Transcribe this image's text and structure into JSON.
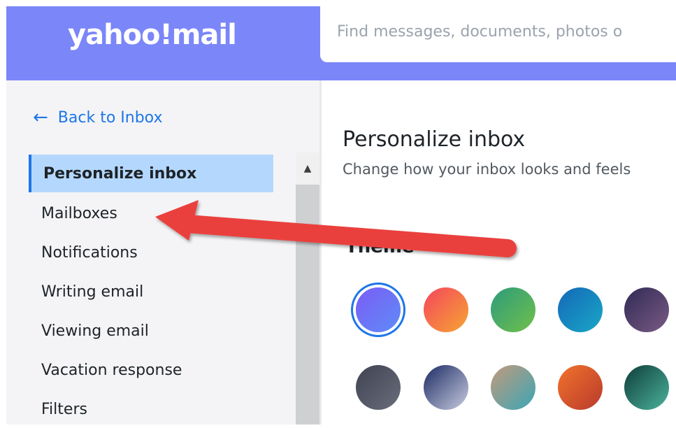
{
  "header": {
    "logo_text": "yahoo!mail",
    "search_placeholder": "Find messages, documents, photos o"
  },
  "sidebar": {
    "back_label": "Back to Inbox",
    "items": [
      {
        "label": "Personalize inbox",
        "active": true
      },
      {
        "label": "Mailboxes"
      },
      {
        "label": "Notifications"
      },
      {
        "label": "Writing email"
      },
      {
        "label": "Viewing email"
      },
      {
        "label": "Vacation response"
      },
      {
        "label": "Filters"
      }
    ]
  },
  "content": {
    "title": "Personalize inbox",
    "subtitle": "Change how your inbox looks and feels",
    "theme_heading": "Theme"
  },
  "themes": [
    {
      "name": "purple-blue",
      "colors": [
        "#7b5cf6",
        "#5e8cf7"
      ],
      "selected": true
    },
    {
      "name": "sunset-orange",
      "colors": [
        "#f5455e",
        "#f5a532"
      ]
    },
    {
      "name": "green",
      "colors": [
        "#2e9b7c",
        "#6fc04a"
      ]
    },
    {
      "name": "ocean-blue",
      "colors": [
        "#1468b8",
        "#19a7c6"
      ]
    },
    {
      "name": "dusk-purple",
      "colors": [
        "#2f2a55",
        "#7a5b84"
      ]
    },
    {
      "name": "slate-gray",
      "colors": [
        "#3f4352",
        "#6a6d7a"
      ]
    },
    {
      "name": "mountain-photo",
      "colors": [
        "#1c2a63",
        "#c9cde0"
      ]
    },
    {
      "name": "camper-photo",
      "colors": [
        "#c39a7c",
        "#3aa6b5"
      ]
    },
    {
      "name": "desert-sunset-photo",
      "colors": [
        "#f1732c",
        "#b83a2c"
      ]
    },
    {
      "name": "teal-landscape-photo",
      "colors": [
        "#0f3d3a",
        "#4bb39b"
      ]
    }
  ],
  "annotation": {
    "color": "#ea3f3d"
  }
}
